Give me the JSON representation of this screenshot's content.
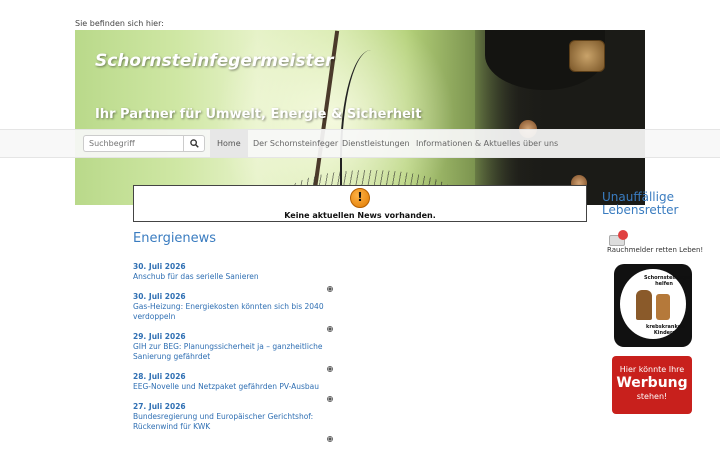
{
  "breadcrumb": {
    "label": "Sie befinden sich hier:"
  },
  "banner": {
    "title": "Schornsteinfegermeister",
    "subtitle": "Ihr Partner für Umwelt, Energie & Sicherheit"
  },
  "navbar": {
    "search_placeholder": "Suchbegriff",
    "search_icon": "search-icon",
    "items": [
      {
        "label": "Home",
        "active": true
      },
      {
        "label": "Der Schornsteinfeger",
        "active": false
      },
      {
        "label": "Dienstleistungen",
        "active": false
      },
      {
        "label": "Informationen & Aktuelles",
        "active": false
      },
      {
        "label": "über uns",
        "active": false
      }
    ]
  },
  "news_box": {
    "icon": "warning-icon",
    "message": "Keine aktuellen News vorhanden."
  },
  "energienews": {
    "title": "Energienews",
    "items": [
      {
        "date": "30. Juli 2026",
        "title": "Anschub für das serielle Sanieren"
      },
      {
        "date": "30. Juli 2026",
        "title": "Gas-Heizung: Energiekosten könnten sich bis 2040 verdoppeln"
      },
      {
        "date": "29. Juli 2026",
        "title": "GIH zur BEG: Planungssicherheit ja – ganzheitliche Sanierung gefährdet"
      },
      {
        "date": "28. Juli 2026",
        "title": "EEG-Novelle und Netzpaket gefährden PV-Ausbau"
      },
      {
        "date": "27. Juli 2026",
        "title": "Bundesregierung und Europäischer Gerichtshof: Rückenwind für KWK"
      }
    ]
  },
  "sidebar": {
    "title": "Unauffällige Lebensretter",
    "smoke_detector_text": "Rauchmelder retten Leben!",
    "badge_top": "Schornsteinfeger helfen",
    "badge_bottom": "krebskranken Kindern",
    "ad_line1": "Hier könnte Ihre",
    "ad_line2": "Werbung",
    "ad_line3": "stehen!"
  },
  "colors": {
    "link_blue": "#2f6fb3",
    "heading_blue": "#3a7cc0",
    "ad_red": "#c8201c"
  }
}
